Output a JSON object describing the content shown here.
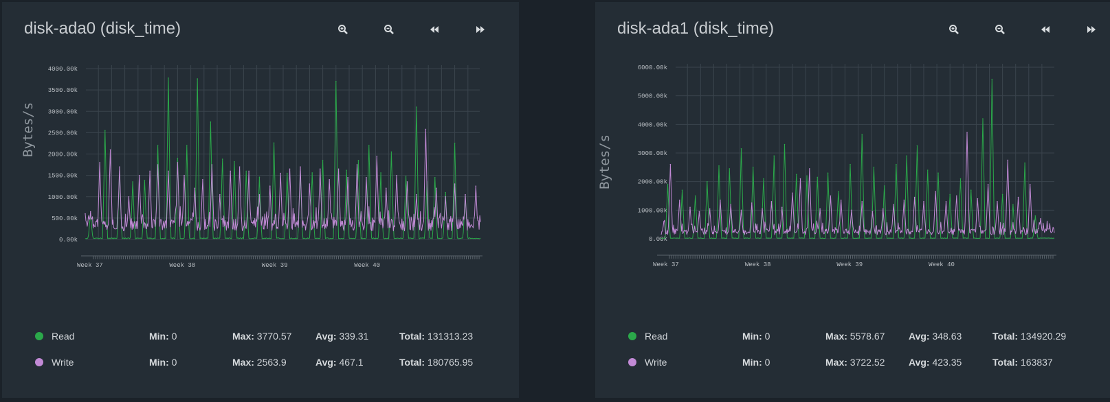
{
  "colors": {
    "read": "#2ba84a",
    "write": "#c28ad6",
    "grid": "#3a444d",
    "axis_text": "#b9bec3",
    "axis_label": "#8f979e"
  },
  "toolbar_icons": [
    "zoom-in-icon",
    "zoom-out-icon",
    "rewind-icon",
    "fast-forward-icon"
  ],
  "cards": [
    {
      "title": "disk-ada0 (disk_time)",
      "ylabel": "Bytes/s",
      "stats": [
        {
          "name": "Read",
          "min_label": "Min:",
          "min": "0",
          "max_label": "Max:",
          "max": "3770.57",
          "avg_label": "Avg:",
          "avg": "339.31",
          "total_label": "Total:",
          "total": "131313.23"
        },
        {
          "name": "Write",
          "min_label": "Min:",
          "min": "0",
          "max_label": "Max:",
          "max": "2563.9",
          "avg_label": "Avg:",
          "avg": "467.1",
          "total_label": "Total:",
          "total": "180765.95"
        }
      ]
    },
    {
      "title": "disk-ada1 (disk_time)",
      "ylabel": "Bytes/s",
      "stats": [
        {
          "name": "Read",
          "min_label": "Min:",
          "min": "0",
          "max_label": "Max:",
          "max": "5578.67",
          "avg_label": "Avg:",
          "avg": "348.63",
          "total_label": "Total:",
          "total": "134920.29"
        },
        {
          "name": "Write",
          "min_label": "Min:",
          "min": "0",
          "max_label": "Max:",
          "max": "3722.52",
          "avg_label": "Avg:",
          "avg": "423.35",
          "total_label": "Total:",
          "total": "163837"
        }
      ]
    }
  ],
  "chart_data": [
    {
      "type": "line",
      "ylabel": "Bytes/s",
      "ylim": [
        0,
        4000
      ],
      "yticks": [
        0,
        500,
        1000,
        1500,
        2000,
        2500,
        3000,
        3500,
        4000
      ],
      "ytick_labels": [
        "0.00k",
        "500.00k",
        "1000.00k",
        "1500.00k",
        "2000.00k",
        "2500.00k",
        "3000.00k",
        "3500.00k",
        "4000.00k"
      ],
      "xlim": [
        0,
        30
      ],
      "xticks": [
        0,
        7,
        14,
        21
      ],
      "xtick_labels": [
        "Week 37",
        "Week 38",
        "Week 39",
        "Week 40"
      ],
      "grid": true,
      "series": [
        {
          "name": "Read",
          "x": [
            0.4,
            1.5,
            2.6,
            3.6,
            4.5,
            5.5,
            6.3,
            7.0,
            7.7,
            8.5,
            9.5,
            10.4,
            11.3,
            12.2,
            13.2,
            14.3,
            15.3,
            16.3,
            17.2,
            18.0,
            19.0,
            19.8,
            20.7,
            21.5,
            22.4,
            23.2,
            24.3,
            25.1,
            25.9,
            26.5,
            27.3,
            28.0,
            28.8
          ],
          "values": [
            600,
            2550,
            1600,
            1350,
            1380,
            2200,
            3780,
            1900,
            2200,
            3760,
            2750,
            1880,
            1820,
            1600,
            1460,
            2260,
            1550,
            1580,
            1560,
            1850,
            3700,
            1620,
            1850,
            2200,
            1560,
            2050,
            1480,
            3100,
            1350,
            1450,
            1100,
            2250,
            1000
          ],
          "base": 25
        },
        {
          "name": "Write",
          "x": [
            0.0,
            0.4,
            1.1,
            1.9,
            2.6,
            3.3,
            4.1,
            4.9,
            5.5,
            6.3,
            7.0,
            7.5,
            8.3,
            8.9,
            9.6,
            10.2,
            11.0,
            11.7,
            12.4,
            13.2,
            14.0,
            14.8,
            15.5,
            16.3,
            17.0,
            17.8,
            18.5,
            19.2,
            19.9,
            20.6,
            21.3,
            22.1,
            22.8,
            23.6,
            24.4,
            25.1,
            25.8,
            26.6,
            27.3,
            28.0,
            28.8,
            29.6
          ],
          "values": [
            600,
            650,
            1800,
            2100,
            1700,
            1000,
            1500,
            1600,
            1750,
            1600,
            1800,
            1500,
            1200,
            1400,
            1750,
            1050,
            1600,
            1700,
            1600,
            1050,
            1250,
            1550,
            1650,
            1700,
            1300,
            1650,
            1400,
            1650,
            1450,
            1750,
            1450,
            1950,
            1200,
            1500,
            1350,
            1050,
            2580,
            1200,
            1000,
            1300,
            1050,
            1250
          ],
          "base": 330
        }
      ]
    },
    {
      "type": "line",
      "ylabel": "Bytes/s",
      "ylim": [
        0,
        6000
      ],
      "yticks": [
        0,
        1000,
        2000,
        3000,
        4000,
        5000,
        6000
      ],
      "ytick_labels": [
        "0.00k",
        "1000.00k",
        "2000.00k",
        "3000.00k",
        "4000.00k",
        "5000.00k",
        "6000.00k"
      ],
      "xlim": [
        0,
        30
      ],
      "xticks": [
        0,
        7,
        14,
        21
      ],
      "xtick_labels": [
        "Week 37",
        "Week 38",
        "Week 39",
        "Week 40"
      ],
      "grid": true,
      "series": [
        {
          "name": "Read",
          "x": [
            0.5,
            1.6,
            2.6,
            3.5,
            4.4,
            5.2,
            6.1,
            7.0,
            7.8,
            8.6,
            9.4,
            10.3,
            11.1,
            11.9,
            12.7,
            13.5,
            14.4,
            15.3,
            16.2,
            17.0,
            17.9,
            18.7,
            19.5,
            20.3,
            21.1,
            22.0,
            22.8,
            23.6,
            24.5,
            25.2,
            26.0,
            26.8,
            27.7,
            28.5
          ],
          "values": [
            1900,
            1700,
            1500,
            2000,
            2550,
            2450,
            3150,
            2500,
            2100,
            2900,
            3300,
            2250,
            2200,
            2150,
            2300,
            1650,
            2600,
            3650,
            2500,
            1850,
            2600,
            2900,
            3250,
            2400,
            2300,
            1550,
            2100,
            1700,
            4200,
            5580,
            1550,
            1200,
            2650,
            800
          ],
          "base": 20
        },
        {
          "name": "Write",
          "x": [
            0.2,
            0.7,
            1.4,
            2.2,
            2.9,
            3.7,
            4.5,
            5.3,
            6.1,
            6.9,
            7.7,
            8.4,
            9.2,
            10.0,
            10.6,
            11.3,
            12.1,
            12.9,
            13.7,
            14.5,
            15.3,
            16.1,
            16.9,
            17.7,
            18.5,
            19.3,
            20.0,
            20.9,
            21.7,
            22.5,
            23.3,
            24.1,
            24.9,
            25.6,
            26.4,
            27.2,
            28.1,
            28.9
          ],
          "values": [
            600,
            2600,
            1350,
            1100,
            950,
            1050,
            1350,
            1200,
            1000,
            1250,
            1050,
            1300,
            1100,
            1600,
            2100,
            2450,
            1050,
            1500,
            1350,
            1000,
            1300,
            950,
            1050,
            1200,
            1350,
            1450,
            1300,
            1650,
            1300,
            1500,
            3720,
            1400,
            1900,
            1300,
            2750,
            1450,
            1900,
            700
          ],
          "base": 230
        }
      ]
    }
  ]
}
